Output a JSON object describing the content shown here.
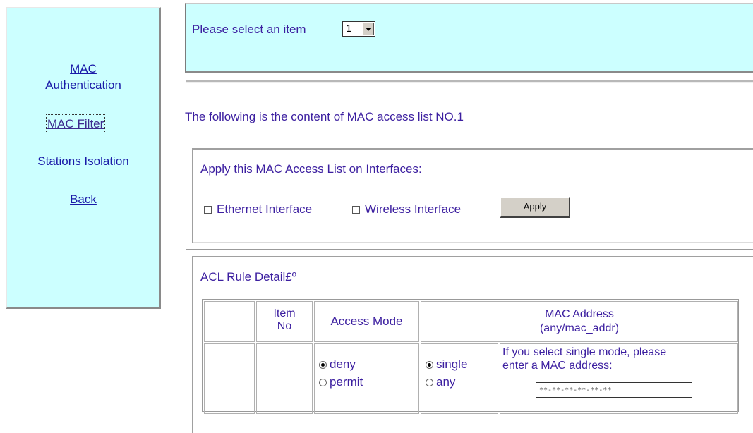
{
  "nav": {
    "items": [
      {
        "line1": "MAC",
        "line2": "Authentication"
      },
      {
        "label": "MAC Filter"
      },
      {
        "label": "Stations Isolation"
      },
      {
        "label": "Back"
      }
    ]
  },
  "select": {
    "label": "Please select an item",
    "value": "1"
  },
  "heading": "The following is the content of MAC access list NO.1",
  "interfaces": {
    "title": "Apply this MAC Access List on Interfaces:",
    "ethernet_label": "Ethernet Interface",
    "wireless_label": "Wireless Interface",
    "apply_label": "Apply"
  },
  "acl": {
    "title": "ACL Rule Detail£º",
    "headers": {
      "item_no_1": "Item",
      "item_no_2": "No",
      "access_mode": "Access Mode",
      "mac_address_1": "MAC Address",
      "mac_address_2": "(any/mac_addr)"
    },
    "access_options": [
      "deny",
      "permit"
    ],
    "access_selected": "deny",
    "mode_options": [
      "single",
      "any"
    ],
    "mode_selected": "single",
    "hint_line1": "If you select single mode, please",
    "hint_line2": "enter a MAC address:",
    "mac_value": "**-**-**-**-**-**"
  }
}
